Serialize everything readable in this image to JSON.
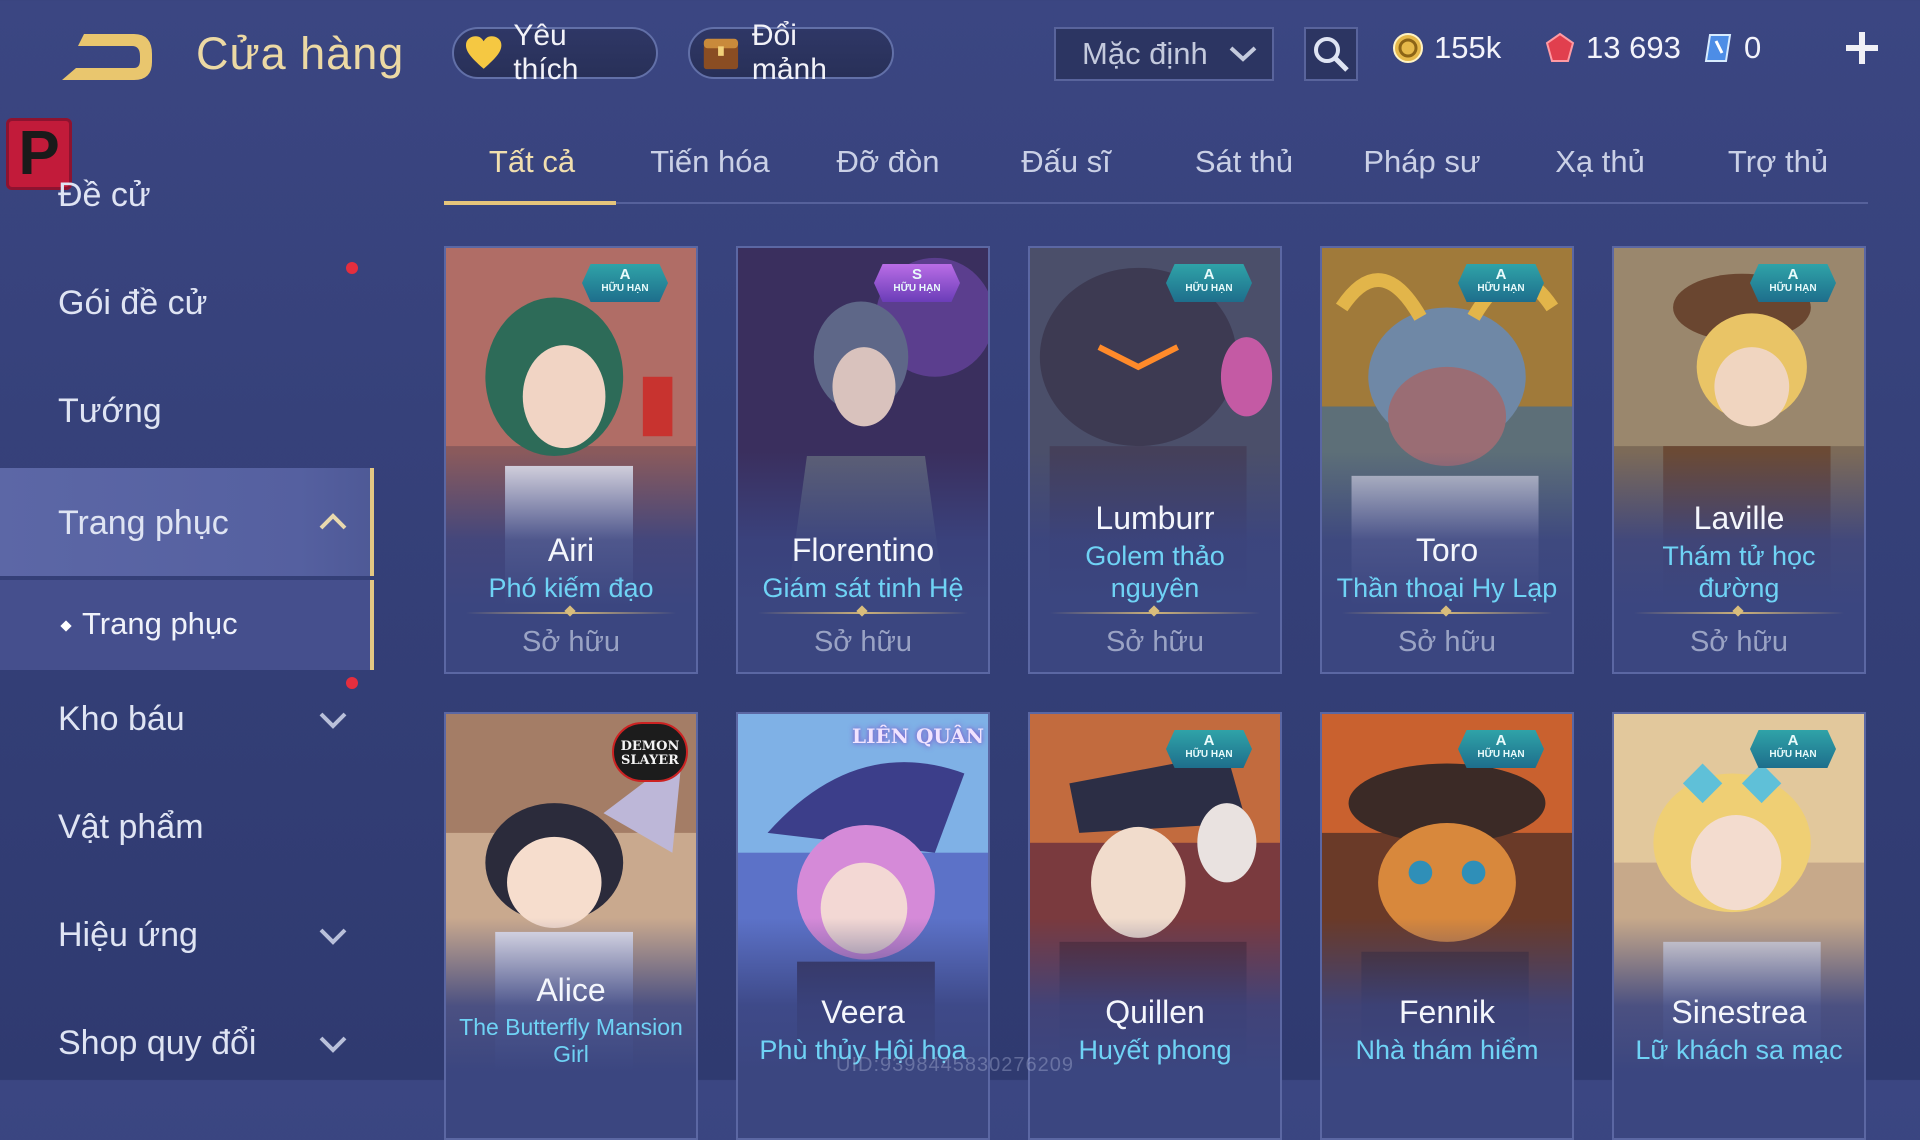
{
  "header": {
    "title": "Cửa hàng",
    "favorites_label": "Yêu thích",
    "fragments_label": "Đổi mảnh",
    "sort_value": "Mặc định",
    "currencies": [
      {
        "icon": "gold-coin-icon",
        "value": "155k"
      },
      {
        "icon": "voucher-gem-icon",
        "value": "13 693"
      },
      {
        "icon": "crystal-icon",
        "value": "0"
      }
    ]
  },
  "sidebar": {
    "logo_letter": "P",
    "items": [
      {
        "label": "Đề cử"
      },
      {
        "label": "Gói đề cử"
      },
      {
        "label": "Tướng"
      },
      {
        "label": "Trang phục"
      },
      {
        "label": "Kho báu"
      },
      {
        "label": "Vật phẩm"
      },
      {
        "label": "Hiệu ứng"
      },
      {
        "label": "Shop quy đổi"
      }
    ],
    "sub_item": "Trang phục"
  },
  "tabs": [
    "Tất cả",
    "Tiến hóa",
    "Đỡ đòn",
    "Đấu sĩ",
    "Sát thủ",
    "Pháp sư",
    "Xạ thủ",
    "Trợ thủ"
  ],
  "cards": [
    {
      "hero": "Airi",
      "skin": "Phó kiếm đạo",
      "status": "Sở hữu",
      "rank": "A",
      "badge_text": "HỮU HẠN"
    },
    {
      "hero": "Florentino",
      "skin": "Giám sát tinh Hệ",
      "status": "Sở hữu",
      "rank": "S",
      "badge_text": "HỮU HẠN"
    },
    {
      "hero": "Lumburr",
      "skin": "Golem thảo nguyên",
      "status": "Sở hữu",
      "rank": "A",
      "badge_text": "HỮU HẠN"
    },
    {
      "hero": "Toro",
      "skin": "Thần thoại Hy Lạp",
      "status": "Sở hữu",
      "rank": "A",
      "badge_text": "HỮU HẠN"
    },
    {
      "hero": "Laville",
      "skin": "Thám tử học đường",
      "status": "Sở hữu",
      "rank": "A",
      "badge_text": "HỮU HẠN"
    },
    {
      "hero": "Alice",
      "skin": "The Butterfly Mansion Girl",
      "collab": "DEMON SLAYER"
    },
    {
      "hero": "Veera",
      "skin": "Phù thủy Hội họa",
      "collab": "LIÊN QUÂN"
    },
    {
      "hero": "Quillen",
      "skin": "Huyết phong",
      "rank": "A",
      "badge_text": "HỮU HẠN"
    },
    {
      "hero": "Fennik",
      "skin": "Nhà thám hiểm",
      "rank": "A",
      "badge_text": "HỮU HẠN"
    },
    {
      "hero": "Sinestrea",
      "skin": "Lữ khách sa mạc",
      "rank": "A",
      "badge_text": "HỮU HẠN"
    }
  ],
  "watermark": "UID:9398445830276209"
}
